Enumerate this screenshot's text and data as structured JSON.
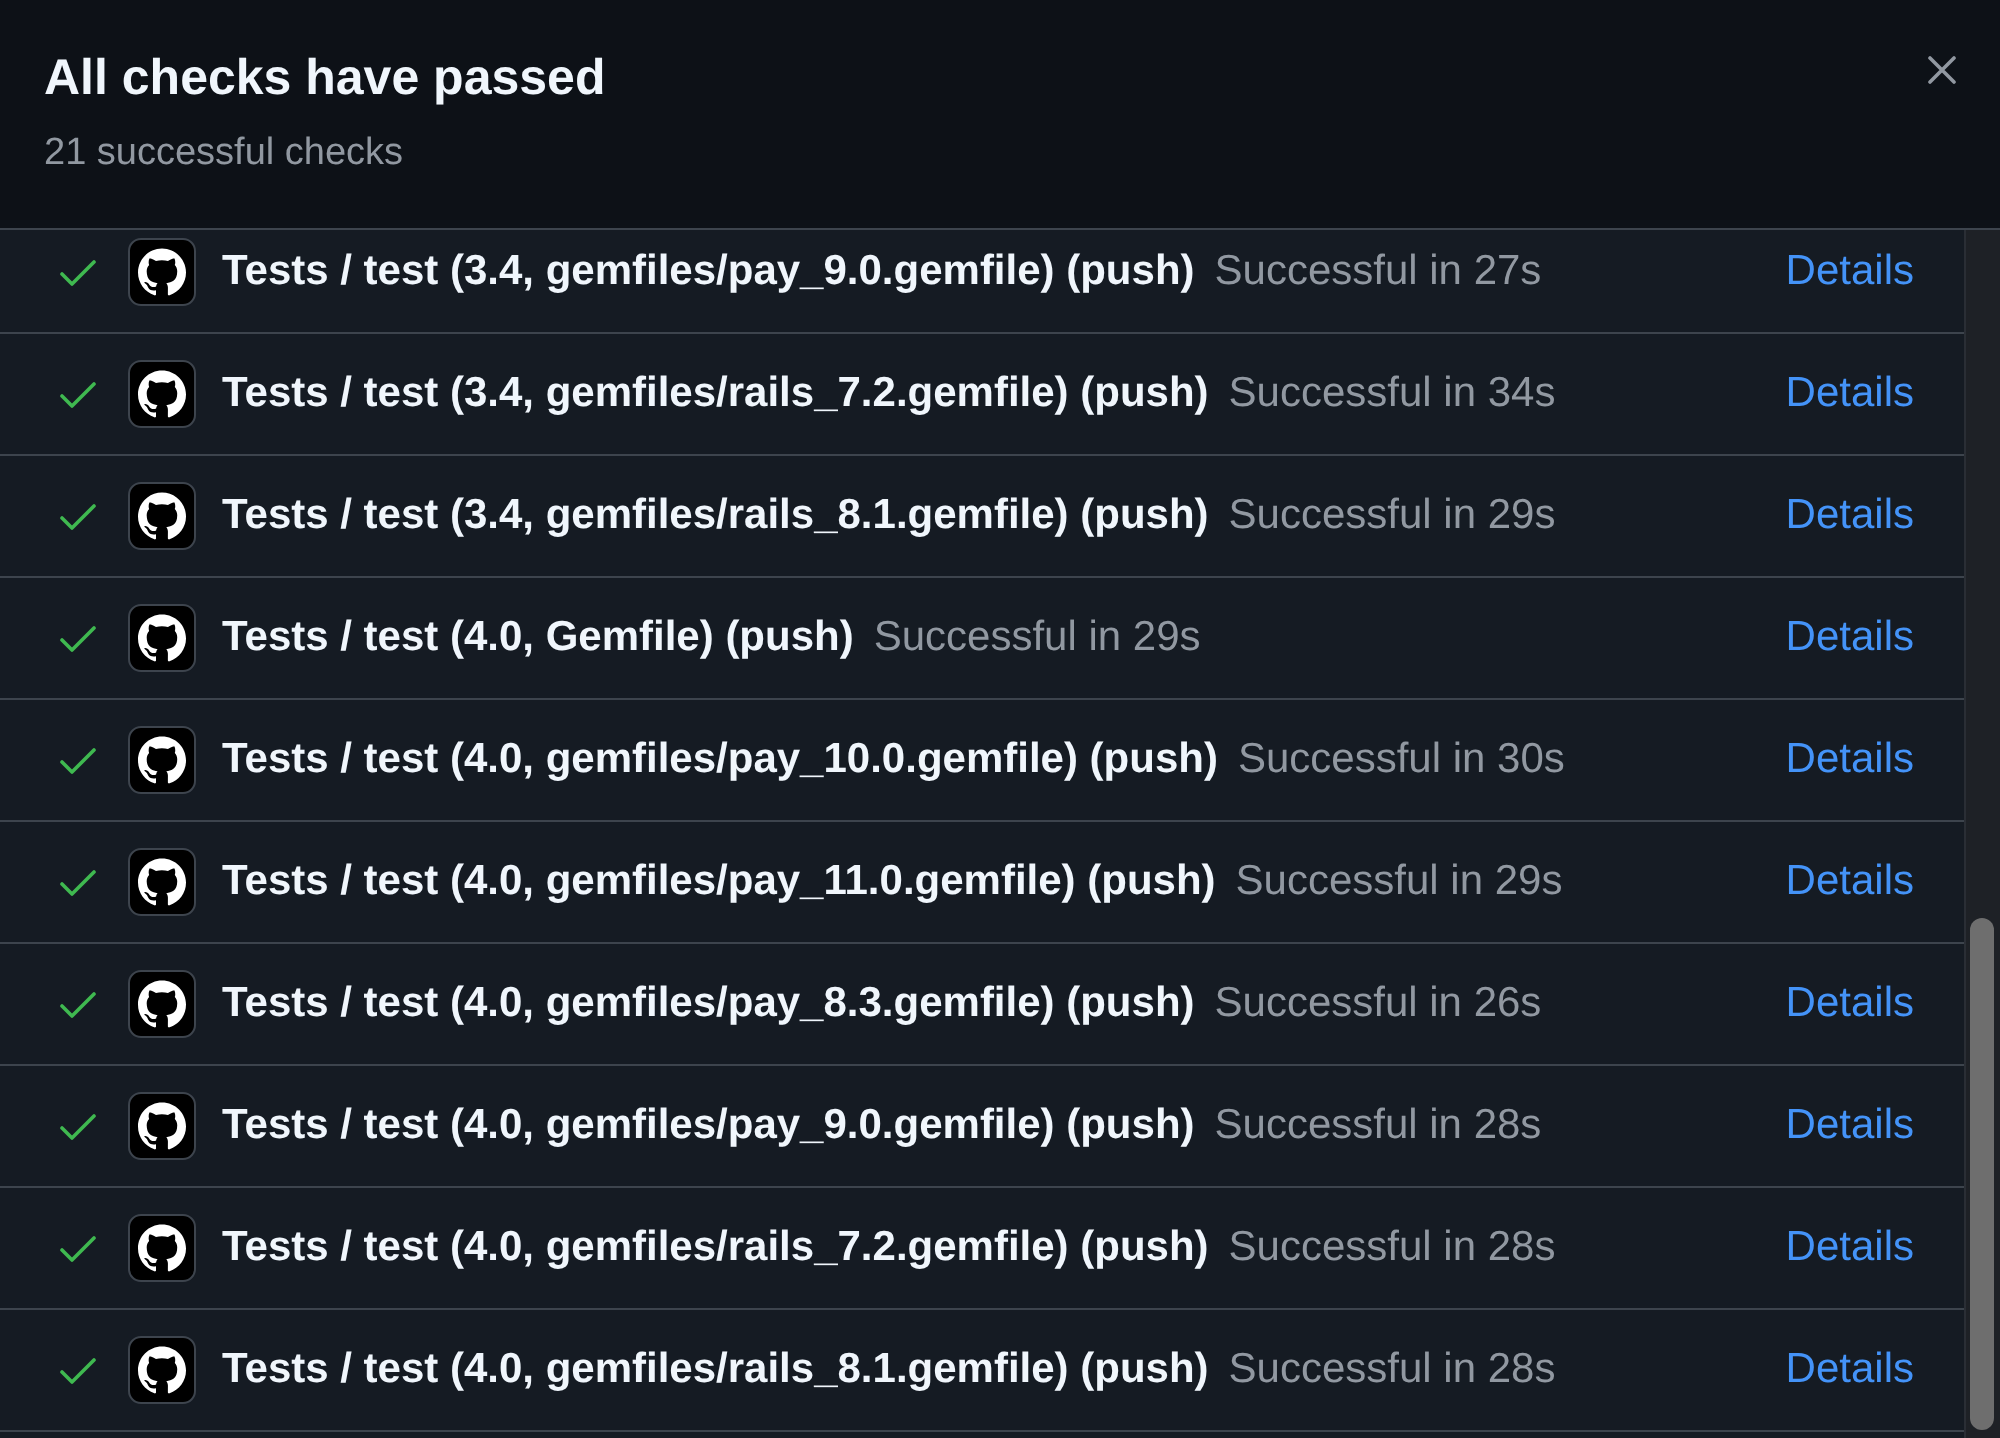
{
  "dialog": {
    "title": "All checks have passed",
    "subtitle": "21 successful checks"
  },
  "checks": [
    {
      "passed": true,
      "name": "Tests / test (3.4, gemfiles/pay_9.0.gemfile) (push)",
      "result": "Successful in 27s",
      "link": "Details"
    },
    {
      "passed": true,
      "name": "Tests / test (3.4, gemfiles/rails_7.2.gemfile) (push)",
      "result": "Successful in 34s",
      "link": "Details"
    },
    {
      "passed": true,
      "name": "Tests / test (3.4, gemfiles/rails_8.1.gemfile) (push)",
      "result": "Successful in 29s",
      "link": "Details"
    },
    {
      "passed": true,
      "name": "Tests / test (4.0, Gemfile) (push)",
      "result": "Successful in 29s",
      "link": "Details"
    },
    {
      "passed": true,
      "name": "Tests / test (4.0, gemfiles/pay_10.0.gemfile) (push)",
      "result": "Successful in 30s",
      "link": "Details"
    },
    {
      "passed": true,
      "name": "Tests / test (4.0, gemfiles/pay_11.0.gemfile) (push)",
      "result": "Successful in 29s",
      "link": "Details"
    },
    {
      "passed": true,
      "name": "Tests / test (4.0, gemfiles/pay_8.3.gemfile) (push)",
      "result": "Successful in 26s",
      "link": "Details"
    },
    {
      "passed": true,
      "name": "Tests / test (4.0, gemfiles/pay_9.0.gemfile) (push)",
      "result": "Successful in 28s",
      "link": "Details"
    },
    {
      "passed": true,
      "name": "Tests / test (4.0, gemfiles/rails_7.2.gemfile) (push)",
      "result": "Successful in 28s",
      "link": "Details"
    },
    {
      "passed": true,
      "name": "Tests / test (4.0, gemfiles/rails_8.1.gemfile) (push)",
      "result": "Successful in 28s",
      "link": "Details"
    }
  ]
}
